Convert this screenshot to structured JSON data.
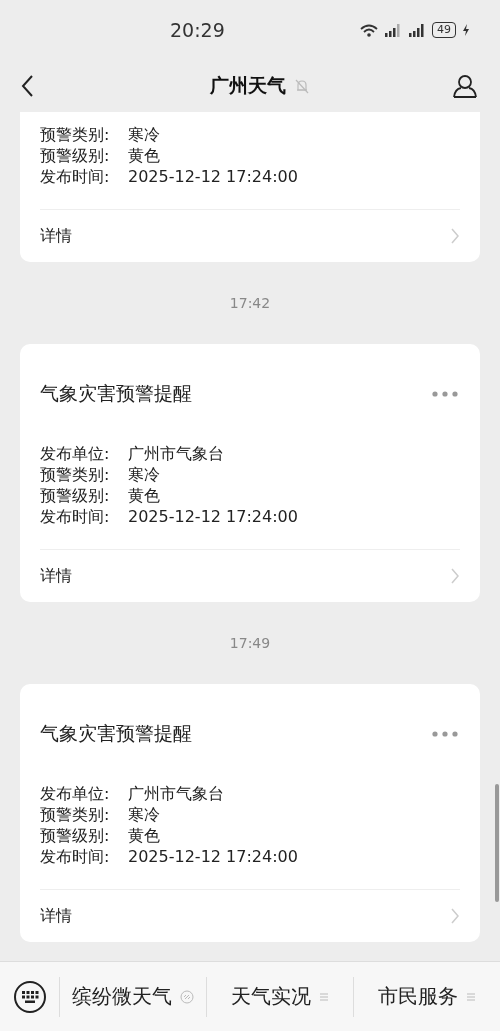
{
  "status_bar": {
    "time": "20:29",
    "battery": "49"
  },
  "header": {
    "title": "广州天气",
    "muted": true
  },
  "feed": [
    {
      "kind": "card",
      "fields": [
        {
          "label": "预警类别:",
          "value": "寒冷"
        },
        {
          "label": "预警级别:",
          "value": "黄色"
        },
        {
          "label": "发布时间:",
          "value": "2025-12-12 17:24:00"
        }
      ],
      "link": "详情"
    },
    {
      "kind": "time",
      "text": "17:42"
    },
    {
      "kind": "card",
      "title": "气象灾害预警提醒",
      "fields": [
        {
          "label": "发布单位:",
          "value": "广州市气象台"
        },
        {
          "label": "预警类别:",
          "value": "寒冷"
        },
        {
          "label": "预警级别:",
          "value": "黄色"
        },
        {
          "label": "发布时间:",
          "value": "2025-12-12 17:24:00"
        }
      ],
      "link": "详情"
    },
    {
      "kind": "time",
      "text": "17:49"
    },
    {
      "kind": "card",
      "title": "气象灾害预警提醒",
      "fields": [
        {
          "label": "发布单位:",
          "value": "广州市气象台"
        },
        {
          "label": "预警类别:",
          "value": "寒冷"
        },
        {
          "label": "预警级别:",
          "value": "黄色"
        },
        {
          "label": "发布时间:",
          "value": "2025-12-12 17:24:00"
        }
      ],
      "link": "详情"
    }
  ],
  "bottom_menu": [
    {
      "label": "缤纷微天气",
      "kind": "mini-program"
    },
    {
      "label": "天气实况",
      "kind": "submenu"
    },
    {
      "label": "市民服务",
      "kind": "submenu"
    }
  ]
}
